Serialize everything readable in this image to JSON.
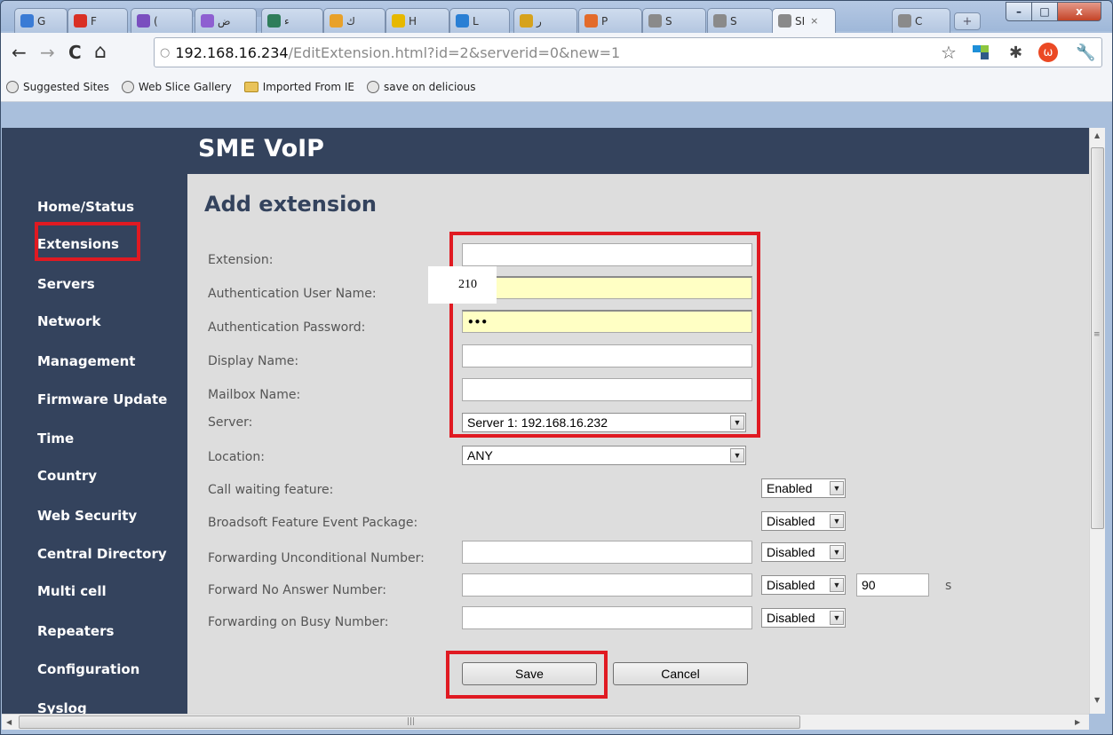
{
  "window": {
    "minimize_label": "–",
    "maximize_label": "□",
    "close_label": "x"
  },
  "tabs": [
    {
      "label": "G",
      "favicon": "gmail-photos-icon",
      "color": "#3a7bd5"
    },
    {
      "label": "F",
      "favicon": "gmail-icon",
      "color": "#d93025"
    },
    {
      "label": "(",
      "favicon": "mail-icon",
      "color": "#7a4fbf"
    },
    {
      "label": "ض",
      "favicon": "circle-icon",
      "color": "#8e5fd1"
    },
    {
      "label": "ء",
      "favicon": "p-icon",
      "color": "#2f7d5a"
    },
    {
      "label": "ك",
      "favicon": "star-icon",
      "color": "#e8a12a"
    },
    {
      "label": "H",
      "favicon": "h-icon",
      "color": "#e6b800"
    },
    {
      "label": "L",
      "favicon": "chart-icon",
      "color": "#2a7fd4"
    },
    {
      "label": "ر",
      "favicon": "graph-icon",
      "color": "#d6a21c"
    },
    {
      "label": "P",
      "favicon": "puzzle-icon",
      "color": "#e36b2b"
    },
    {
      "label": "S",
      "favicon": "globe-icon",
      "color": "#8a8a8a"
    },
    {
      "label": "S",
      "favicon": "globe-icon",
      "color": "#8a8a8a"
    },
    {
      "label": "SI",
      "favicon": "globe-icon",
      "color": "#8a8a8a",
      "active": true,
      "close": "×"
    },
    {
      "label": "C",
      "favicon": "globe-icon",
      "color": "#8a8a8a"
    }
  ],
  "newtab_label": "+",
  "nav": {
    "back": "←",
    "forward": "→",
    "reload": "C",
    "home": "⌂"
  },
  "address": {
    "page_icon": "○",
    "host": "192.168.16.234",
    "path": "/EditExtension.html?id=2&serverid=0&new=1"
  },
  "toolbar_icons": {
    "bookmark_star": "☆",
    "bug": "✱",
    "stumble": "ω",
    "wrench": "🔧"
  },
  "bookmarks": [
    {
      "label": "Suggested Sites",
      "icon": "globe-icon"
    },
    {
      "label": "Web Slice Gallery",
      "icon": "globe-icon"
    },
    {
      "label": "Imported From IE",
      "icon": "folder-icon"
    },
    {
      "label": "save on delicious",
      "icon": "globe-icon"
    }
  ],
  "brand": "SME VoIP",
  "sidebar": [
    "Home/Status",
    "Extensions",
    "Servers",
    "Network",
    "Management",
    "Firmware Update",
    "Time",
    "Country",
    "Web Security",
    "Central Directory",
    "Multi cell",
    "Repeaters",
    "Configuration",
    "Syslog"
  ],
  "page_title": "Add extension",
  "form": {
    "extension_label": "Extension:",
    "extension_value": "",
    "auth_user_label": "Authentication User Name:",
    "auth_user_value": "",
    "auth_pass_label": "Authentication Password:",
    "auth_pass_value": "•••",
    "display_name_label": "Display Name:",
    "display_name_value": "",
    "mailbox_label": "Mailbox Name:",
    "mailbox_value": "",
    "server_label": "Server:",
    "server_value": "Server 1: 192.168.16.232",
    "location_label": "Location:",
    "location_value": "ANY",
    "call_waiting_label": "Call waiting feature:",
    "call_waiting_value": "Enabled",
    "broadsoft_label": "Broadsoft Feature Event Package:",
    "broadsoft_value": "Disabled",
    "fwd_uncond_label": "Forwarding Unconditional Number:",
    "fwd_uncond_value": "",
    "fwd_uncond_state": "Disabled",
    "fwd_noans_label": "Forward No Answer Number:",
    "fwd_noans_value": "",
    "fwd_noans_state": "Disabled",
    "fwd_noans_timeout": "90",
    "fwd_noans_unit": "s",
    "fwd_busy_label": "Forwarding on Busy Number:",
    "fwd_busy_value": "",
    "fwd_busy_state": "Disabled",
    "dropdown_arrow": "▼"
  },
  "buttons": {
    "save": "Save",
    "cancel": "Cancel"
  },
  "tooltip_value": "210",
  "scroll": {
    "up": "▲",
    "down": "▼",
    "left": "◀",
    "right": "▶",
    "grip_v": "≡",
    "grip_h": "|||"
  },
  "colors": {
    "nav_bg": "#34435d",
    "highlight": "#e01a22",
    "autofill": "#ffffc4"
  }
}
